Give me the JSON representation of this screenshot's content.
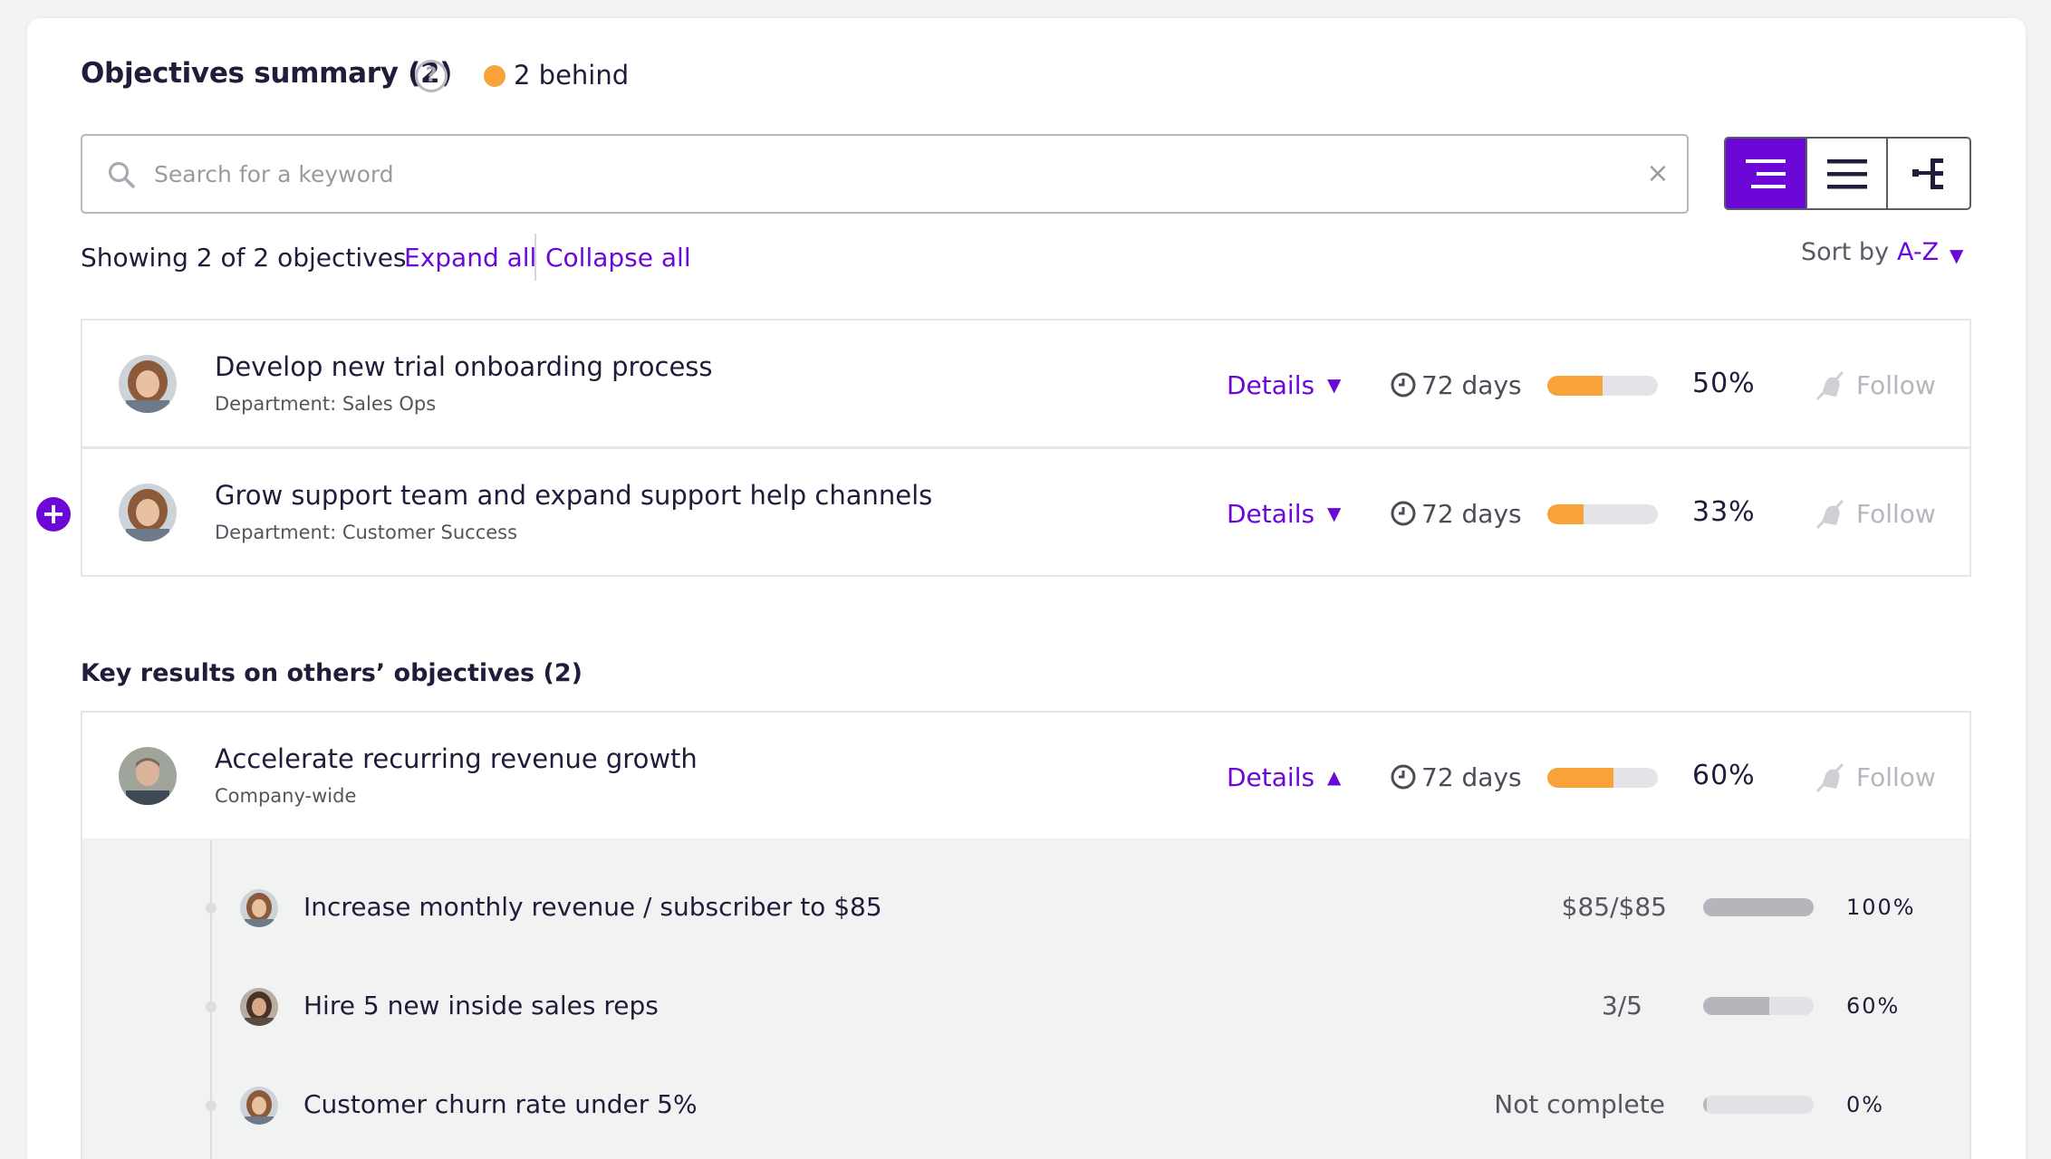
{
  "header": {
    "title": "Objectives summary (2)",
    "help_icon": "question-circle-icon",
    "status_text": "2 behind",
    "status_color": "#f7a33a"
  },
  "search": {
    "placeholder": "Search for a keyword",
    "value": "",
    "clear_glyph": "×"
  },
  "view_toggle": {
    "options": [
      "indented-list-view",
      "list-view",
      "tree-view"
    ],
    "active": "indented-list-view"
  },
  "list_controls": {
    "showing": "Showing 2 of 2 objectives",
    "expand_all": "Expand all",
    "collapse_all": "Collapse all",
    "sort_label": "Sort by",
    "sort_value": "A-Z"
  },
  "objectives": [
    {
      "title": "Develop new trial onboarding process",
      "subtitle": "Department: Sales Ops",
      "details": "Details",
      "days": "72 days",
      "progress": 0.5,
      "percent": "50%",
      "follow": "Follow"
    },
    {
      "title": "Grow support team and expand support help channels",
      "subtitle": "Department: Customer Success",
      "details": "Details",
      "days": "72 days",
      "progress": 0.33,
      "percent": "33%",
      "follow": "Follow"
    }
  ],
  "others": {
    "title": "Key results on others’ objectives (2)",
    "objective": {
      "title": "Accelerate recurring revenue growth",
      "subtitle": "Company-wide",
      "details": "Details",
      "days": "72 days",
      "progress": 0.6,
      "percent": "60%",
      "follow": "Follow"
    },
    "key_results": [
      {
        "label": "Increase monthly revenue / subscriber to $85",
        "value": "$85/$85",
        "progress": 1.0,
        "percent": "100%"
      },
      {
        "label": "Hire 5 new inside sales reps",
        "value": "3/5",
        "progress": 0.6,
        "percent": "60%"
      },
      {
        "label": "Customer churn rate under 5%",
        "value": "Not complete",
        "progress": 0.0,
        "percent": "0%"
      }
    ]
  },
  "colors": {
    "accent": "#6b08d8",
    "progress_orange": "#f7a33a",
    "kr_progress_gray": "#b4b6bb"
  }
}
